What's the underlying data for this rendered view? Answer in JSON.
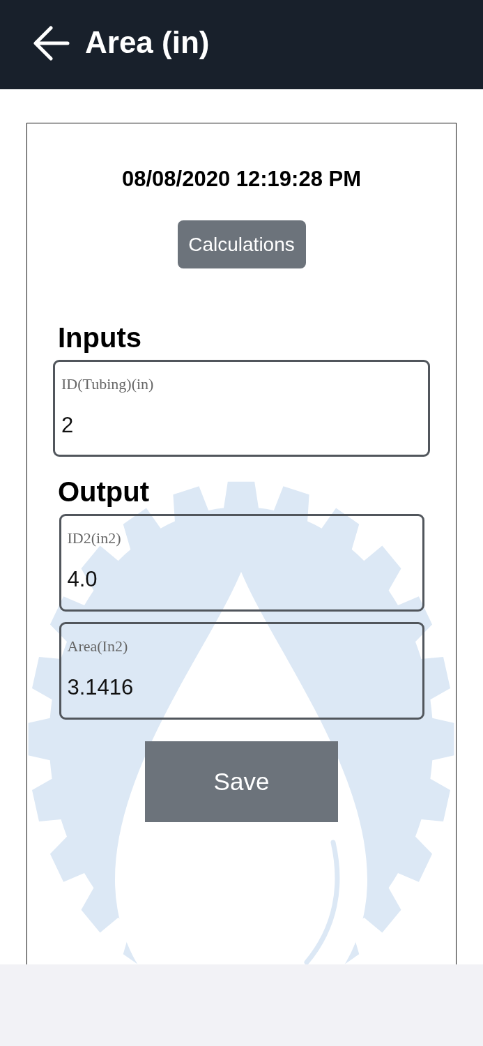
{
  "header": {
    "title": "Area (in)"
  },
  "form": {
    "timestamp": "08/08/2020 12:19:28 PM",
    "calculations_button": "Calculations",
    "sections": [
      {
        "kind": "inputs",
        "heading": "Inputs",
        "fields": [
          {
            "label": "ID(Tubing)(in)",
            "value": "2"
          }
        ]
      },
      {
        "kind": "outputs",
        "heading": "Output",
        "fields": [
          {
            "label": "ID2(in2)",
            "value": "4.0"
          },
          {
            "label": "Area(In2)",
            "value": "3.1416"
          }
        ]
      }
    ],
    "save_button": "Save"
  }
}
